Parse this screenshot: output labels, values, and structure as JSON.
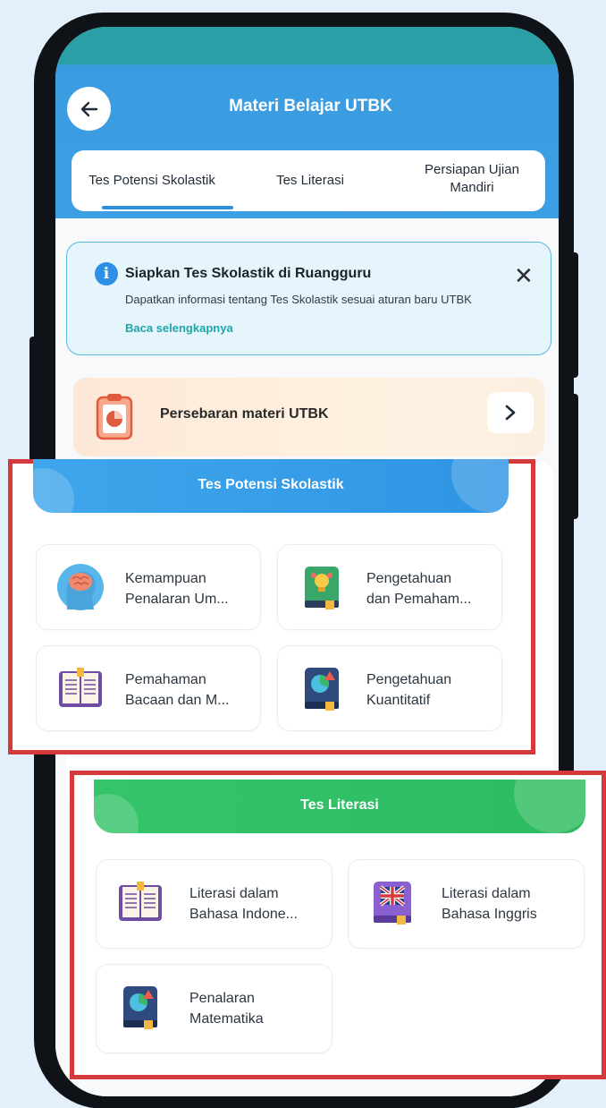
{
  "header": {
    "title": "Materi Belajar UTBK"
  },
  "tabs": [
    {
      "label": "Tes Potensi Skolastik"
    },
    {
      "label": "Tes Literasi"
    },
    {
      "label": "Persiapan Ujian Mandiri",
      "line1": "Persiapan Ujian",
      "line2": "Mandiri"
    }
  ],
  "info_banner": {
    "title": "Siapkan Tes Skolastik di Ruangguru",
    "description": "Dapatkan informasi tentang Tes Skolastik sesuai aturan baru UTBK",
    "link": "Baca selengkapnya"
  },
  "distribution": {
    "label": "Persebaran materi UTBK"
  },
  "skolastik": {
    "title": "Tes Potensi Skolastik",
    "items": [
      {
        "line1": "Kemampuan",
        "line2": "Penalaran Um...",
        "icon": "brain-head-icon"
      },
      {
        "line1": "Pengetahuan",
        "line2": "dan Pemaham...",
        "icon": "book-bulb-icon"
      },
      {
        "line1": "Pemahaman",
        "line2": "Bacaan dan M...",
        "icon": "open-book-icon"
      },
      {
        "line1": "Pengetahuan",
        "line2": "Kuantitatif",
        "icon": "book-chart-icon"
      }
    ]
  },
  "literasi": {
    "title": "Tes Literasi",
    "items": [
      {
        "line1": "Literasi dalam",
        "line2": "Bahasa Indone...",
        "icon": "open-book-icon"
      },
      {
        "line1": "Literasi dalam",
        "line2": "Bahasa Inggris",
        "icon": "book-uk-flag-icon"
      },
      {
        "line1": "Penalaran",
        "line2": "Matematika",
        "icon": "book-chart-icon"
      }
    ]
  },
  "colors": {
    "header_blue": "#3ea0e8",
    "highlight_red": "#d4393b",
    "literasi_green": "#34c46a",
    "teal_link": "#1fa5a8"
  }
}
